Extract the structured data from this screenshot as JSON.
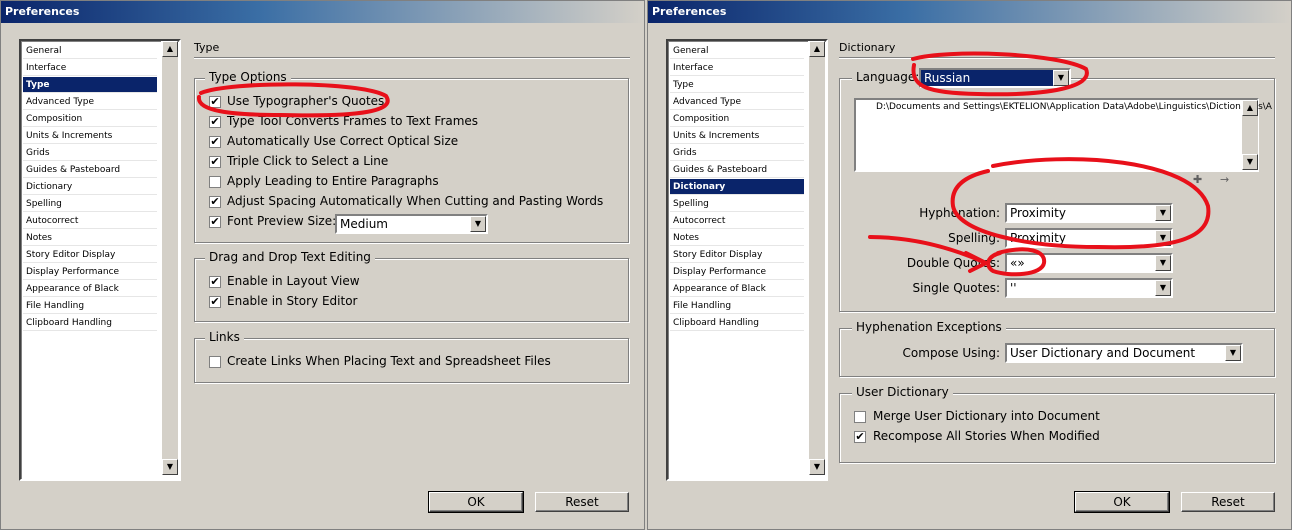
{
  "left": {
    "title": "Preferences",
    "categories": [
      "General",
      "Interface",
      "Type",
      "Advanced Type",
      "Composition",
      "Units & Increments",
      "Grids",
      "Guides & Pasteboard",
      "Dictionary",
      "Spelling",
      "Autocorrect",
      "Notes",
      "Story Editor Display",
      "Display Performance",
      "Appearance of Black",
      "File Handling",
      "Clipboard Handling"
    ],
    "selected": "Type",
    "section_title": "Type",
    "type_options": {
      "label": "Type Options",
      "items": [
        {
          "label": "Use Typographer's Quotes",
          "checked": true
        },
        {
          "label": "Type Tool Converts Frames to Text Frames",
          "checked": true
        },
        {
          "label": "Automatically Use Correct Optical Size",
          "checked": true
        },
        {
          "label": "Triple Click to Select a Line",
          "checked": true
        },
        {
          "label": "Apply Leading to Entire Paragraphs",
          "checked": false
        },
        {
          "label": "Adjust Spacing Automatically When Cutting and Pasting Words",
          "checked": true
        },
        {
          "label": "Font Preview Size:",
          "checked": true
        }
      ],
      "font_preview_value": "Medium"
    },
    "drag_drop": {
      "label": "Drag and Drop Text Editing",
      "items": [
        {
          "label": "Enable in Layout View",
          "checked": true
        },
        {
          "label": "Enable in Story Editor",
          "checked": true
        }
      ]
    },
    "links": {
      "label": "Links",
      "items": [
        {
          "label": "Create Links When Placing Text and Spreadsheet Files",
          "checked": false
        }
      ]
    },
    "ok": "OK",
    "reset": "Reset"
  },
  "right": {
    "title": "Preferences",
    "categories": [
      "General",
      "Interface",
      "Type",
      "Advanced Type",
      "Composition",
      "Units & Increments",
      "Grids",
      "Guides & Pasteboard",
      "Dictionary",
      "Spelling",
      "Autocorrect",
      "Notes",
      "Story Editor Display",
      "Display Performance",
      "Appearance of Black",
      "File Handling",
      "Clipboard Handling"
    ],
    "selected": "Dictionary",
    "section_title": "Dictionary",
    "language_label": "Language:",
    "language_value": "Russian",
    "dictionary_path": "D:\\Documents and Settings\\EKTELION\\Application Data\\Adobe\\Linguistics\\Dictionaries\\A",
    "hyphenation_label": "Hyphenation:",
    "hyphenation_value": "Proximity",
    "spelling_label": "Spelling:",
    "spelling_value": "Proximity",
    "double_quotes_label": "Double Quotes:",
    "double_quotes_value": "«»",
    "single_quotes_label": "Single Quotes:",
    "single_quotes_value": "''",
    "hyph_exceptions": {
      "label": "Hyphenation Exceptions",
      "compose_label": "Compose Using:",
      "compose_value": "User Dictionary and Document"
    },
    "user_dictionary": {
      "label": "User Dictionary",
      "items": [
        {
          "label": "Merge User Dictionary into Document",
          "checked": false
        },
        {
          "label": "Recompose All Stories When Modified",
          "checked": true
        }
      ]
    },
    "ok": "OK",
    "reset": "Reset"
  },
  "colors": {
    "selection": "#0a246a",
    "annotation": "#e8101a",
    "face": "#d4d0c8"
  }
}
